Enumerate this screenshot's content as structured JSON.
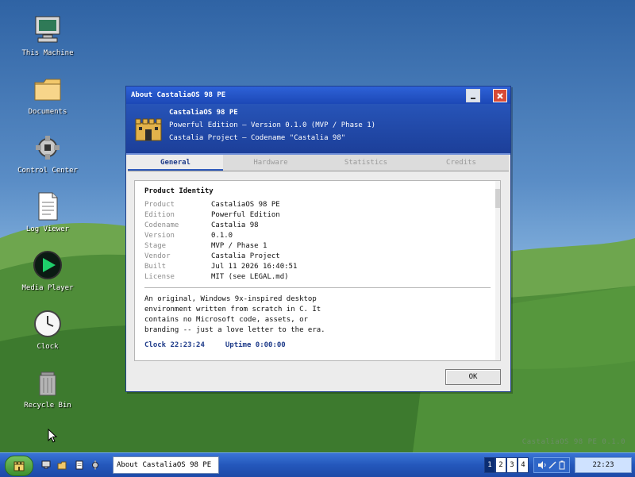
{
  "desktop": {
    "watermark": "CastaliaOS 98 PE  0.1.0",
    "icons": [
      {
        "label": "This Machine",
        "icon": "computer-icon"
      },
      {
        "label": "Documents",
        "icon": "folder-icon"
      },
      {
        "label": "Control Center",
        "icon": "gear-icon"
      },
      {
        "label": "Log Viewer",
        "icon": "document-icon"
      },
      {
        "label": "Media Player",
        "icon": "media-play-icon"
      },
      {
        "label": "Clock",
        "icon": "clock-icon"
      },
      {
        "label": "Recycle Bin",
        "icon": "trash-icon"
      }
    ]
  },
  "window": {
    "title": "About CastaliaOS 98 PE",
    "header": {
      "line1": "CastaliaOS 98 PE",
      "line2": "Powerful Edition  –  Version 0.1.0  (MVP / Phase 1)",
      "line3": "Castalia Project  –  Codename \"Castalia 98\""
    },
    "tabs": [
      {
        "label": "General",
        "active": true
      },
      {
        "label": "Hardware",
        "active": false
      },
      {
        "label": "Statistics",
        "active": false
      },
      {
        "label": "Credits",
        "active": false
      }
    ],
    "section_title": "Product Identity",
    "fields": [
      {
        "key": "Product",
        "value": "CastaliaOS 98 PE"
      },
      {
        "key": "Edition",
        "value": "Powerful Edition"
      },
      {
        "key": "Codename",
        "value": "Castalia 98"
      },
      {
        "key": "Version",
        "value": "0.1.0"
      },
      {
        "key": "Stage",
        "value": "MVP / Phase 1"
      },
      {
        "key": "Vendor",
        "value": "Castalia Project"
      },
      {
        "key": "Built",
        "value": "Jul 11 2026  16:40:51"
      },
      {
        "key": "License",
        "value": "MIT (see LEGAL.md)"
      }
    ],
    "description_lines": [
      "An original, Windows 9x-inspired desktop",
      "environment written from scratch in C. It",
      "contains no Microsoft code, assets, or",
      "branding -- just a love letter to the era."
    ],
    "status": {
      "clock": "Clock 22:23:24",
      "uptime": "Uptime 0:00:00"
    },
    "ok_label": "OK"
  },
  "taskbar": {
    "task_label": "About CastaliaOS 98 PE",
    "workspaces": [
      "1",
      "2",
      "3",
      "4"
    ],
    "clock": "22:23"
  }
}
